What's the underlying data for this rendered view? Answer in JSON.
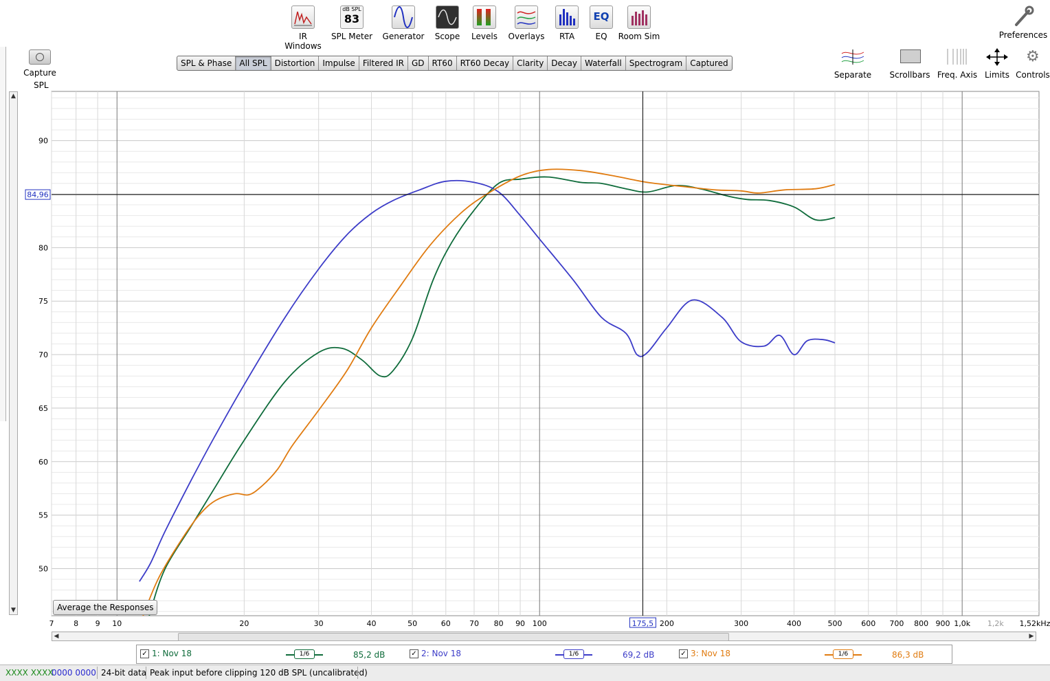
{
  "toolbar": {
    "items": [
      {
        "label": "IR Windows",
        "icon": "ir-windows-icon"
      },
      {
        "label": "SPL Meter",
        "icon": "spl-meter-icon",
        "meter_caption": "dB SPL",
        "meter_value": "83"
      },
      {
        "label": "Generator",
        "icon": "generator-icon"
      },
      {
        "label": "Scope",
        "icon": "scope-icon"
      },
      {
        "label": "Levels",
        "icon": "levels-icon"
      },
      {
        "label": "Overlays",
        "icon": "overlays-icon"
      },
      {
        "label": "RTA",
        "icon": "rta-icon"
      },
      {
        "label": "EQ",
        "icon": "eq-icon"
      },
      {
        "label": "Room Sim",
        "icon": "room-sim-icon"
      }
    ],
    "preferences_label": "Preferences"
  },
  "capture": {
    "label": "Capture"
  },
  "tabs": [
    "SPL & Phase",
    "All SPL",
    "Distortion",
    "Impulse",
    "Filtered IR",
    "GD",
    "RT60",
    "RT60 Decay",
    "Clarity",
    "Decay",
    "Waterfall",
    "Spectrogram",
    "Captured"
  ],
  "active_tab": "All SPL",
  "right_toolbar": [
    {
      "label": "Separate",
      "icon": "separate-icon"
    },
    {
      "label": "Scrollbars",
      "icon": "scrollbars-icon"
    },
    {
      "label": "Freq. Axis",
      "icon": "freq-axis-icon"
    },
    {
      "label": "Limits",
      "icon": "limits-icon"
    },
    {
      "label": "Controls",
      "icon": "controls-icon"
    }
  ],
  "chart_data": {
    "type": "line",
    "ylabel": "SPL",
    "xscale": "log",
    "xlim": [
      7,
      1520
    ],
    "ylim": [
      45.6,
      94.6
    ],
    "y_ticks": [
      50,
      55,
      60,
      65,
      70,
      75,
      80,
      90
    ],
    "x_ticks": [
      {
        "v": 7,
        "label": "7"
      },
      {
        "v": 8,
        "label": "8"
      },
      {
        "v": 9,
        "label": "9"
      },
      {
        "v": 10,
        "label": "10"
      },
      {
        "v": 20,
        "label": "20"
      },
      {
        "v": 30,
        "label": "30"
      },
      {
        "v": 40,
        "label": "40"
      },
      {
        "v": 50,
        "label": "50"
      },
      {
        "v": 60,
        "label": "60"
      },
      {
        "v": 70,
        "label": "70"
      },
      {
        "v": 80,
        "label": "80"
      },
      {
        "v": 90,
        "label": "90"
      },
      {
        "v": 100,
        "label": "100"
      },
      {
        "v": 200,
        "label": "200"
      },
      {
        "v": 300,
        "label": "300"
      },
      {
        "v": 400,
        "label": "400"
      },
      {
        "v": 500,
        "label": "500"
      },
      {
        "v": 600,
        "label": "600"
      },
      {
        "v": 700,
        "label": "700"
      },
      {
        "v": 800,
        "label": "800"
      },
      {
        "v": 900,
        "label": "900"
      },
      {
        "v": 1000,
        "label": "1,0k"
      },
      {
        "v": 1200,
        "label": "1,2k"
      },
      {
        "v": 1520,
        "label": "1,52kHz"
      }
    ],
    "cursor": {
      "y": 84.96,
      "y_label": "84,96",
      "x": 175.5,
      "x_label": "175,5"
    },
    "series": [
      {
        "name": "1: Nov 18",
        "color": "#0e6b3a",
        "points": [
          [
            11.5,
            43
          ],
          [
            12,
            46
          ],
          [
            13,
            50
          ],
          [
            15,
            54
          ],
          [
            17,
            57.5
          ],
          [
            20,
            62
          ],
          [
            25,
            67.5
          ],
          [
            30,
            70.2
          ],
          [
            34,
            70.6
          ],
          [
            38,
            69.5
          ],
          [
            42,
            68
          ],
          [
            45,
            68.5
          ],
          [
            50,
            71.5
          ],
          [
            56,
            77
          ],
          [
            62,
            80.5
          ],
          [
            70,
            83.5
          ],
          [
            80,
            86
          ],
          [
            90,
            86.4
          ],
          [
            105,
            86.6
          ],
          [
            125,
            86.1
          ],
          [
            140,
            86
          ],
          [
            160,
            85.5
          ],
          [
            180,
            85.2
          ],
          [
            210,
            85.8
          ],
          [
            240,
            85.5
          ],
          [
            280,
            84.8
          ],
          [
            310,
            84.5
          ],
          [
            350,
            84.4
          ],
          [
            400,
            83.8
          ],
          [
            450,
            82.6
          ],
          [
            500,
            82.8
          ]
        ]
      },
      {
        "name": "2: Nov 18",
        "color": "#3c3cc8",
        "points": [
          [
            11.3,
            48.8
          ],
          [
            12,
            50.5
          ],
          [
            13,
            53.5
          ],
          [
            15,
            58.3
          ],
          [
            17,
            62.3
          ],
          [
            20,
            67.2
          ],
          [
            25,
            73.5
          ],
          [
            30,
            78
          ],
          [
            35,
            81.2
          ],
          [
            40,
            83.2
          ],
          [
            45,
            84.4
          ],
          [
            52,
            85.4
          ],
          [
            60,
            86.2
          ],
          [
            70,
            86.1
          ],
          [
            80,
            85.2
          ],
          [
            90,
            83
          ],
          [
            100,
            80.8
          ],
          [
            120,
            77
          ],
          [
            140,
            73.5
          ],
          [
            160,
            72
          ],
          [
            170,
            70
          ],
          [
            180,
            70.2
          ],
          [
            200,
            72.5
          ],
          [
            230,
            75.1
          ],
          [
            270,
            73.5
          ],
          [
            300,
            71.2
          ],
          [
            340,
            70.8
          ],
          [
            370,
            71.8
          ],
          [
            400,
            70
          ],
          [
            430,
            71.3
          ],
          [
            470,
            71.4
          ],
          [
            500,
            71.1
          ]
        ]
      },
      {
        "name": "3: Nov 18",
        "color": "#e07b10",
        "points": [
          [
            11.5,
            45.5
          ],
          [
            12.5,
            49
          ],
          [
            14,
            52.3
          ],
          [
            15.5,
            54.8
          ],
          [
            17,
            56.3
          ],
          [
            19,
            57
          ],
          [
            20.5,
            56.9
          ],
          [
            22,
            57.7
          ],
          [
            24,
            59.3
          ],
          [
            26,
            61.5
          ],
          [
            30,
            64.8
          ],
          [
            35,
            68.5
          ],
          [
            40,
            72.5
          ],
          [
            47,
            76.5
          ],
          [
            55,
            80.2
          ],
          [
            65,
            83.2
          ],
          [
            75,
            85
          ],
          [
            90,
            86.7
          ],
          [
            105,
            87.3
          ],
          [
            125,
            87.2
          ],
          [
            150,
            86.7
          ],
          [
            180,
            86.1
          ],
          [
            220,
            85.7
          ],
          [
            260,
            85.4
          ],
          [
            300,
            85.3
          ],
          [
            330,
            85.1
          ],
          [
            380,
            85.4
          ],
          [
            450,
            85.5
          ],
          [
            500,
            85.9
          ]
        ]
      }
    ]
  },
  "average_button": "Average the Responses",
  "legend": [
    {
      "name": "1: Nov 18",
      "smoothing": "1/6",
      "value": "85,2 dB",
      "color": "#0e6b3a"
    },
    {
      "name": "2: Nov 18",
      "smoothing": "1/6",
      "value": "69,2 dB",
      "color": "#3c3cc8"
    },
    {
      "name": "3: Nov 18",
      "smoothing": "1/6",
      "value": "86,3 dB",
      "color": "#e07b10"
    }
  ],
  "status": {
    "xxxx": "XXXX XXXX",
    "zeros": "0000 0000",
    "bits": "24-bit data",
    "peak": "Peak input before clipping 120 dB SPL (uncalibrated)"
  }
}
